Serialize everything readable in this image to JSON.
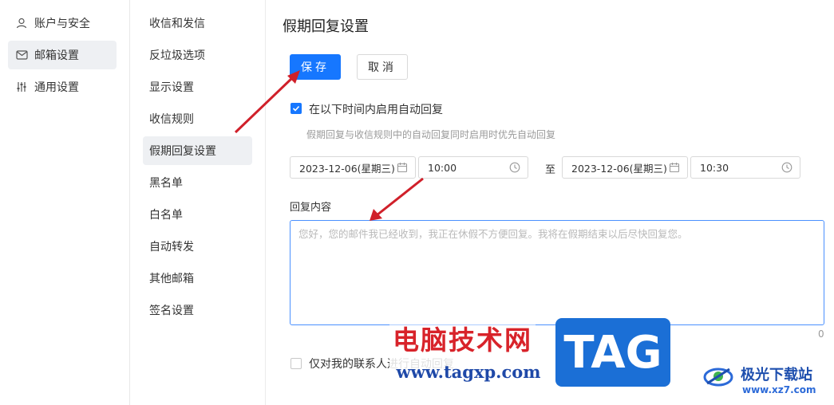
{
  "left_nav": {
    "items": [
      {
        "label": "账户与安全",
        "icon": "user-icon",
        "active": false
      },
      {
        "label": "邮箱设置",
        "icon": "mail-settings-icon",
        "active": true
      },
      {
        "label": "通用设置",
        "icon": "sliders-icon",
        "active": false
      }
    ]
  },
  "sub_nav": {
    "items": [
      {
        "label": "收信和发信"
      },
      {
        "label": "反垃圾选项"
      },
      {
        "label": "显示设置"
      },
      {
        "label": "收信规则"
      },
      {
        "label": "假期回复设置",
        "active": true
      },
      {
        "label": "黑名单"
      },
      {
        "label": "白名单"
      },
      {
        "label": "自动转发"
      },
      {
        "label": "其他邮箱"
      },
      {
        "label": "签名设置"
      }
    ]
  },
  "main": {
    "title": "假期回复设置",
    "save_label": "保存",
    "cancel_label": "取消",
    "enable_auto_reply": {
      "label": "在以下时间内启用自动回复",
      "checked": true
    },
    "hint": "假期回复与收信规则中的自动回复同时启用时优先自动回复",
    "start_date": "2023-12-06(星期三)",
    "start_time": "10:00",
    "to_label": "至",
    "end_date": "2023-12-06(星期三)",
    "end_time": "10:30",
    "reply_label": "回复内容",
    "reply_placeholder": "您好，您的邮件我已经收到，我正在休假不方便回复。我将在假期结束以后尽快回复您。",
    "reply_value": "",
    "char_count": "0",
    "contacts_only": {
      "label": "仅对我的联系人进行自动回复",
      "checked": false
    }
  },
  "watermark": {
    "cn_text": "电脑技术网",
    "url_text": "www.tagxp.com",
    "tag_text": "TAG",
    "site_cn": "极光下载站",
    "site_url": "www.xz7.com"
  },
  "colors": {
    "accent": "#1677ff",
    "annotation_arrow": "#d0202a"
  }
}
